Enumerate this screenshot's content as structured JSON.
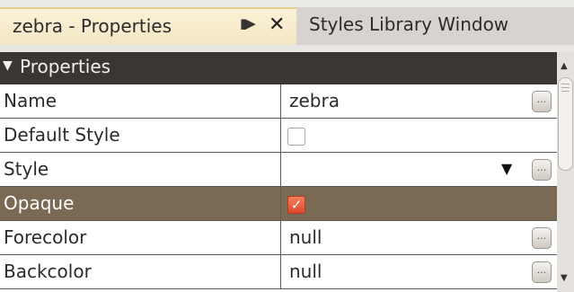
{
  "tabs": [
    {
      "title": "zebra - Properties",
      "maximize_glyph": "▮▶",
      "close_glyph": "✕"
    },
    {
      "title": "Styles Library Window"
    }
  ],
  "properties": {
    "section_arrow": "▼",
    "section_title": "Properties",
    "rows": [
      {
        "name": "Name",
        "value": "zebra"
      },
      {
        "name": "Default Style",
        "value": ""
      },
      {
        "name": "Style",
        "value": ""
      },
      {
        "name": "Opaque",
        "value": ""
      },
      {
        "name": "Forecolor",
        "value": "null"
      },
      {
        "name": "Backcolor",
        "value": "null"
      }
    ],
    "ellipsis": "..."
  },
  "scrollbar": {
    "up_glyph": "▲",
    "down_glyph": "▼"
  },
  "colors": {
    "active_tab": "#fbf1d6",
    "section_header": "#3a3733",
    "selected_row": "#7a6a53",
    "checked": "#dd4a2a"
  },
  "state": {
    "default_style_checked": false,
    "opaque_checked": true
  }
}
